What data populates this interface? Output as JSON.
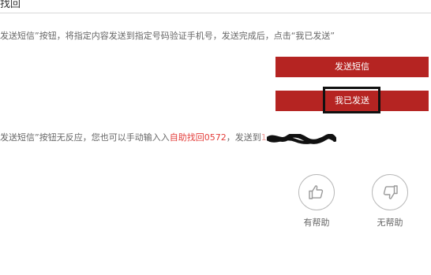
{
  "header": {
    "title": "找回"
  },
  "instruction": {
    "text": "发送短信”按钮，将指定内容发送到指定号码验证手机号，发送完成后，点击“我已发送”"
  },
  "buttons": {
    "send_sms": "发送短信",
    "i_have_sent": "我已发送"
  },
  "fallback": {
    "prefix": "发送短信”按钮无反应，您也可以手动输入入",
    "link_text": "自助找回0572",
    "middle": "，发送到",
    "phone_visible": "1"
  },
  "feedback": {
    "helpful_label": "有帮助",
    "unhelpful_label": "无帮助",
    "helpful_icon": "thumbs-up-icon",
    "unhelpful_icon": "thumbs-down-icon"
  },
  "colors": {
    "accent_red": "#b52422",
    "link_red": "#e33d3a"
  }
}
